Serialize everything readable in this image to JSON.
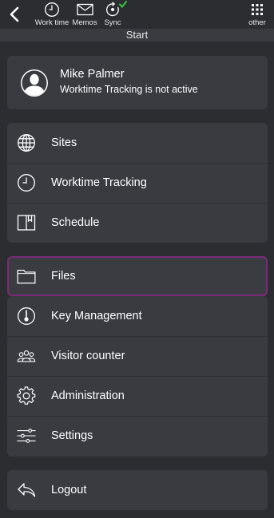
{
  "topbar": {
    "items": [
      {
        "label": "Work time",
        "icon": "clock-icon"
      },
      {
        "label": "Memos",
        "icon": "envelope-icon"
      },
      {
        "label": "Sync",
        "icon": "sync-icon"
      },
      {
        "label": "other",
        "icon": "grid-icon"
      }
    ],
    "sync_ok_color": "#2ecc40"
  },
  "page_title": "Start",
  "profile": {
    "name": "Mike Palmer",
    "status": "Worktime Tracking is not active"
  },
  "menu_group_1": [
    {
      "label": "Sites",
      "icon": "globe-icon"
    },
    {
      "label": "Worktime Tracking",
      "icon": "clock-icon"
    },
    {
      "label": "Schedule",
      "icon": "book-icon"
    }
  ],
  "files": {
    "label": "Files",
    "icon": "folder-icon",
    "highlight_color": "#7a2a78"
  },
  "menu_group_2": [
    {
      "label": "Key Management",
      "icon": "key-icon"
    },
    {
      "label": "Visitor counter",
      "icon": "visitors-icon"
    },
    {
      "label": "Administration",
      "icon": "gear-icon"
    },
    {
      "label": "Settings",
      "icon": "sliders-icon"
    }
  ],
  "logout": {
    "label": "Logout",
    "icon": "logout-icon"
  }
}
